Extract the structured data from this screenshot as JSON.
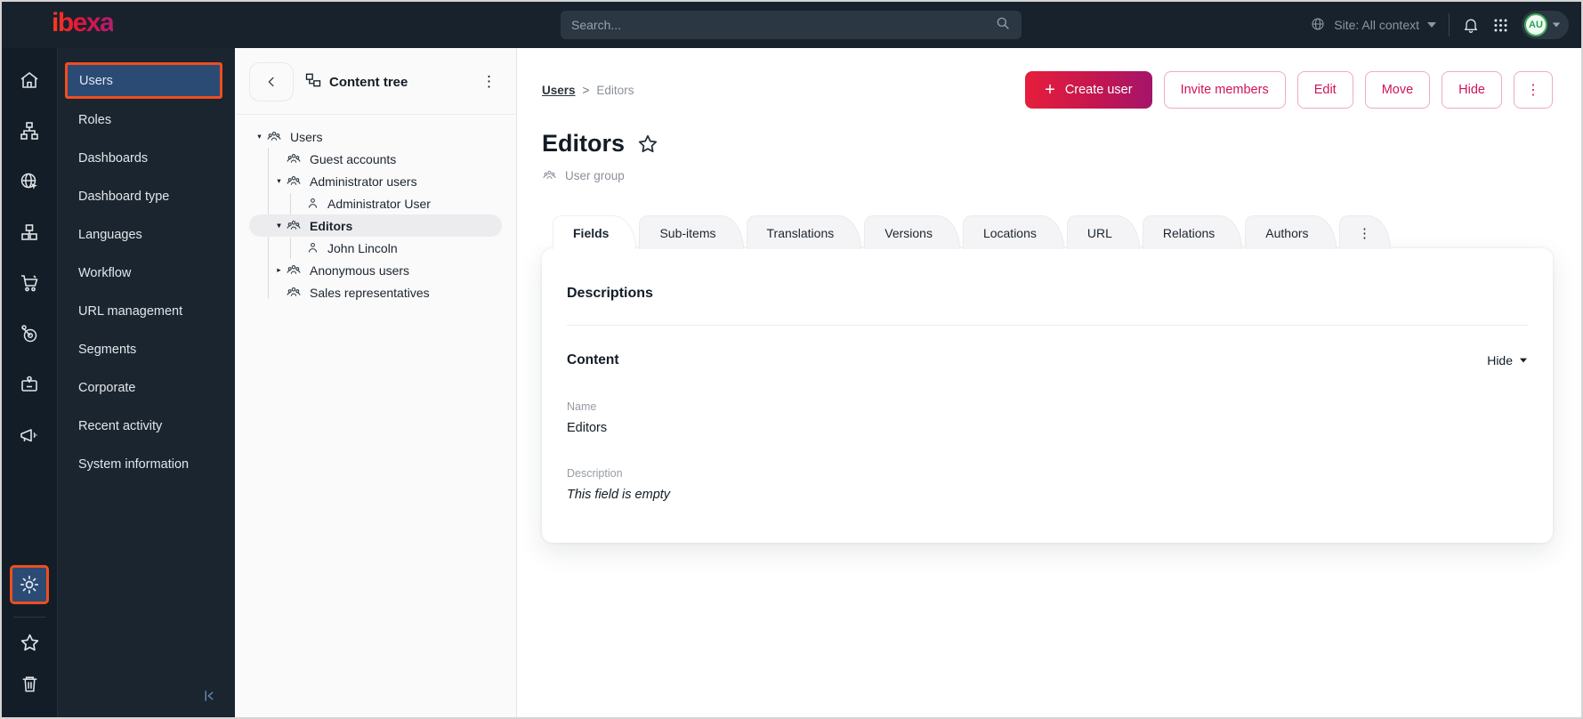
{
  "topbar": {
    "logo_text": "ibexa",
    "search": {
      "placeholder": "Search..."
    },
    "site_context_label": "Site: All context",
    "avatar_initials": "AU"
  },
  "icon_rail": {
    "top_items": [
      "home",
      "site-structure",
      "web",
      "product-catalog",
      "commerce",
      "personalization",
      "corporate",
      "marketing"
    ],
    "bottom_items": [
      "settings",
      "favorites",
      "trash"
    ],
    "highlighted_item": "settings"
  },
  "sidebar": {
    "items": [
      {
        "label": "Users",
        "active": true
      },
      {
        "label": "Roles"
      },
      {
        "label": "Dashboards"
      },
      {
        "label": "Dashboard type"
      },
      {
        "label": "Languages"
      },
      {
        "label": "Workflow"
      },
      {
        "label": "URL management"
      },
      {
        "label": "Segments"
      },
      {
        "label": "Corporate"
      },
      {
        "label": "Recent activity"
      },
      {
        "label": "System information"
      }
    ]
  },
  "content_tree": {
    "title": "Content tree",
    "nodes": [
      {
        "label": "Users",
        "level": 0,
        "icon": "user-group",
        "caret": "down"
      },
      {
        "label": "Guest accounts",
        "level": 1,
        "icon": "user-group",
        "caret": "none"
      },
      {
        "label": "Administrator users",
        "level": 1,
        "icon": "user-group",
        "caret": "down"
      },
      {
        "label": "Administrator User",
        "level": 2,
        "icon": "user",
        "caret": "none"
      },
      {
        "label": "Editors",
        "level": 1,
        "icon": "user-group",
        "caret": "down",
        "selected": true
      },
      {
        "label": "John Lincoln",
        "level": 2,
        "icon": "user",
        "caret": "none"
      },
      {
        "label": "Anonymous users",
        "level": 1,
        "icon": "user-group",
        "caret": "right"
      },
      {
        "label": "Sales representatives",
        "level": 1,
        "icon": "user-group",
        "caret": "none"
      }
    ]
  },
  "main": {
    "breadcrumb": {
      "root": "Users",
      "separator": ">",
      "current": "Editors"
    },
    "actions": {
      "create_user": "Create user",
      "invite_members": "Invite members",
      "edit": "Edit",
      "move": "Move",
      "hide": "Hide"
    },
    "page_title": "Editors",
    "content_type_label": "User group",
    "tabs": [
      {
        "label": "Fields",
        "active": true
      },
      {
        "label": "Sub-items"
      },
      {
        "label": "Translations"
      },
      {
        "label": "Versions"
      },
      {
        "label": "Locations"
      },
      {
        "label": "URL"
      },
      {
        "label": "Relations"
      },
      {
        "label": "Authors"
      }
    ],
    "card": {
      "section_title": "Descriptions",
      "group_title": "Content",
      "collapse_label": "Hide",
      "fields": [
        {
          "label": "Name",
          "value": "Editors",
          "is_empty": false
        },
        {
          "label": "Description",
          "value": "This field is empty",
          "is_empty": true
        }
      ]
    }
  },
  "colors": {
    "topbar_bg": "#17222d",
    "rail_bg": "#121d27",
    "sidebar_bg": "#1a2530",
    "highlight_bg": "#2c4b74",
    "annotation_orange": "#ef4e1f",
    "primary_gradient_start": "#e61e3c",
    "primary_gradient_end": "#a4156b",
    "button_pink": "#d0135a",
    "avatar_green": "#3fae5a"
  }
}
